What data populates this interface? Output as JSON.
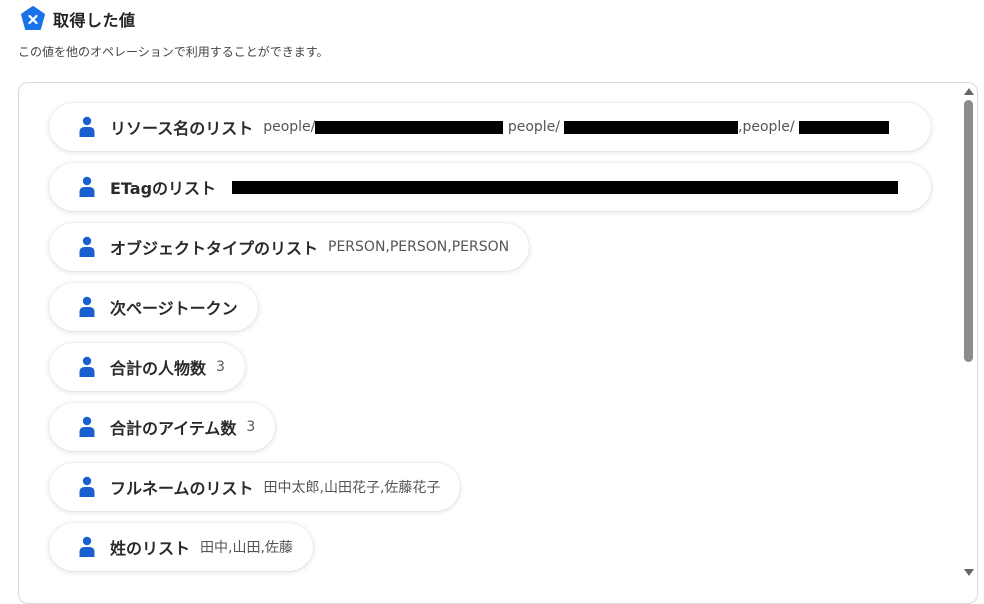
{
  "header": {
    "title": "取得した値",
    "subtitle": "この値を他のオペレーションで利用することができます。",
    "logo_color": "#1a73e8"
  },
  "items": [
    {
      "label": "リソース名のリスト",
      "value_parts": [
        "people/",
        "[REDACTED]",
        " people/",
        "[REDACTED]",
        ",people/",
        "[REDACTED]"
      ]
    },
    {
      "label": "ETagのリスト",
      "value_parts": [
        "[REDACTED]"
      ]
    },
    {
      "label": "オブジェクトタイプのリスト",
      "value": "PERSON,PERSON,PERSON"
    },
    {
      "label": "次ページトークン",
      "value": ""
    },
    {
      "label": "合計の人物数",
      "value": "3"
    },
    {
      "label": "合計のアイテム数",
      "value": "3"
    },
    {
      "label": "フルネームのリスト",
      "value": "田中太郎,山田花子,佐藤花子"
    },
    {
      "label": "姓のリスト",
      "value": "田中,山田,佐藤"
    }
  ],
  "icons": {
    "item_icon": "person-icon",
    "item_icon_color": "#1a5fd0",
    "logo_icon": "yoom-logo-icon"
  }
}
